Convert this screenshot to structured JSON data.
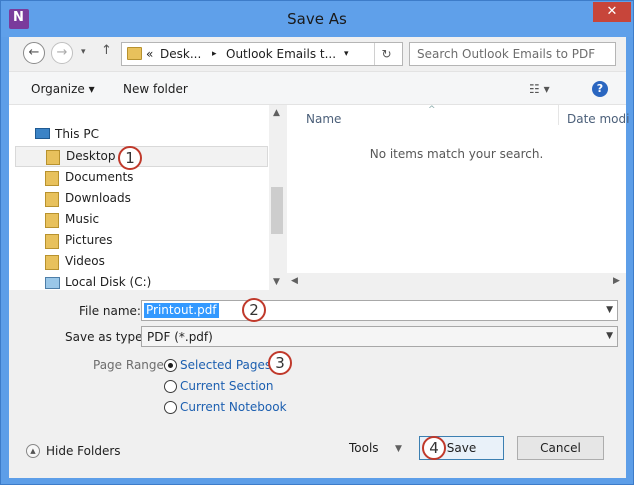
{
  "window": {
    "title": "Save As",
    "close_glyph": "✕"
  },
  "address": {
    "back_glyph": "←",
    "forward_glyph": "→",
    "recent_glyph": "▾",
    "up_glyph": "↑",
    "crumbs": [
      "«",
      "Desk...",
      "▸",
      "Outlook Emails t...",
      "▾"
    ],
    "refresh_glyph": "↻",
    "search_placeholder": "Search Outlook Emails to PDF"
  },
  "toolbar": {
    "organize": "Organize ▾",
    "new_folder": "New folder",
    "view_glyph": "☷ ▾",
    "help_glyph": "?"
  },
  "nav": {
    "items": [
      {
        "label": "This PC",
        "icon": "computer-icon"
      },
      {
        "label": "Desktop",
        "icon": "folder-icon"
      },
      {
        "label": "Documents",
        "icon": "folder-icon"
      },
      {
        "label": "Downloads",
        "icon": "folder-icon"
      },
      {
        "label": "Music",
        "icon": "folder-icon"
      },
      {
        "label": "Pictures",
        "icon": "folder-icon"
      },
      {
        "label": "Videos",
        "icon": "folder-icon"
      },
      {
        "label": "Local Disk (C:)",
        "icon": "disk-icon"
      }
    ]
  },
  "filelist": {
    "col_name": "Name",
    "col_date": "Date modi",
    "empty_message": "No items match your search."
  },
  "form": {
    "file_name_label": "File name:",
    "file_name_value": "Printout.pdf",
    "save_type_label": "Save as type:",
    "save_type_value": "PDF (*.pdf)",
    "page_range_label": "Page Range:",
    "radio_options": [
      "Selected Pages",
      "Current Section",
      "Current Notebook"
    ],
    "selected_option": "Selected Pages"
  },
  "footer": {
    "hide_folders": "Hide Folders",
    "tools": "Tools",
    "save": "Save",
    "cancel": "Cancel"
  },
  "badges": [
    "1",
    "2",
    "3",
    "4"
  ],
  "colors": {
    "titlebar": "#5fa0ea",
    "badge_border": "#c0392b",
    "selection": "#3399ff",
    "link": "#1c5fb0"
  }
}
